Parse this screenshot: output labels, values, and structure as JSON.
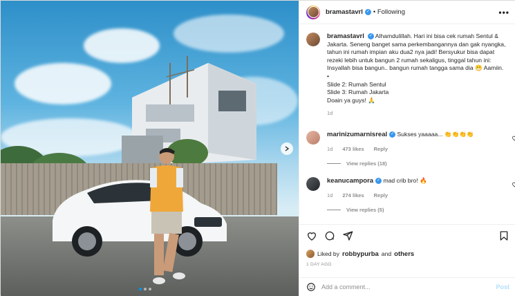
{
  "post": {
    "author": "bramastavrl",
    "following_label": "Following",
    "more_label": "•••",
    "caption_lines": [
      "Alhamdulillah. Hari ini bisa cek rumah Sentul &",
      "Jakarta. Seneng banget sama perkembangannya dan gak nyangka,",
      "tahun ini rumah impian aku dua2 nya jadi! Bersyukur bisa dapat",
      "rezeki lebih untuk bangun 2 rumah sekaligus, tinggal tahun ini:",
      "Insyallah bisa bangun.. bangun rumah tangga sama dia 😁 Aamiin.",
      "•",
      "Slide 2: Rumah Sentul",
      "Slide 3: Rumah Jakarta",
      "Doain ya guys! 🙏"
    ],
    "caption_time": "1d",
    "comments": [
      {
        "user": "marinizumarnisreal",
        "text": "Sukses yaaaaa... 👏👏👏👏",
        "time": "1d",
        "likes": "473 likes",
        "reply": "Reply",
        "view_replies": "View replies (18)"
      },
      {
        "user": "keanucampora",
        "text": "mad crib bro! 🔥",
        "time": "1d",
        "likes": "274 likes",
        "reply": "Reply",
        "view_replies": "View replies (5)"
      }
    ],
    "liked_by_prefix": "Liked by",
    "liked_by_user": "robbypurba",
    "liked_by_suffix": "and",
    "liked_by_others": "others",
    "date": "1 DAY AGO",
    "add_comment_placeholder": "Add a comment...",
    "post_button": "Post"
  },
  "icons": {
    "verified": "verified-badge-icon",
    "next": "chevron-right-icon",
    "heart": "heart-icon",
    "comment": "comment-icon",
    "share": "share-icon",
    "save": "bookmark-icon",
    "emoji": "emoji-icon"
  },
  "colors": {
    "accent": "#0095f6",
    "verified": "#3897f0",
    "muted": "#8e8e8e",
    "post_disabled": "#b2dffc"
  }
}
